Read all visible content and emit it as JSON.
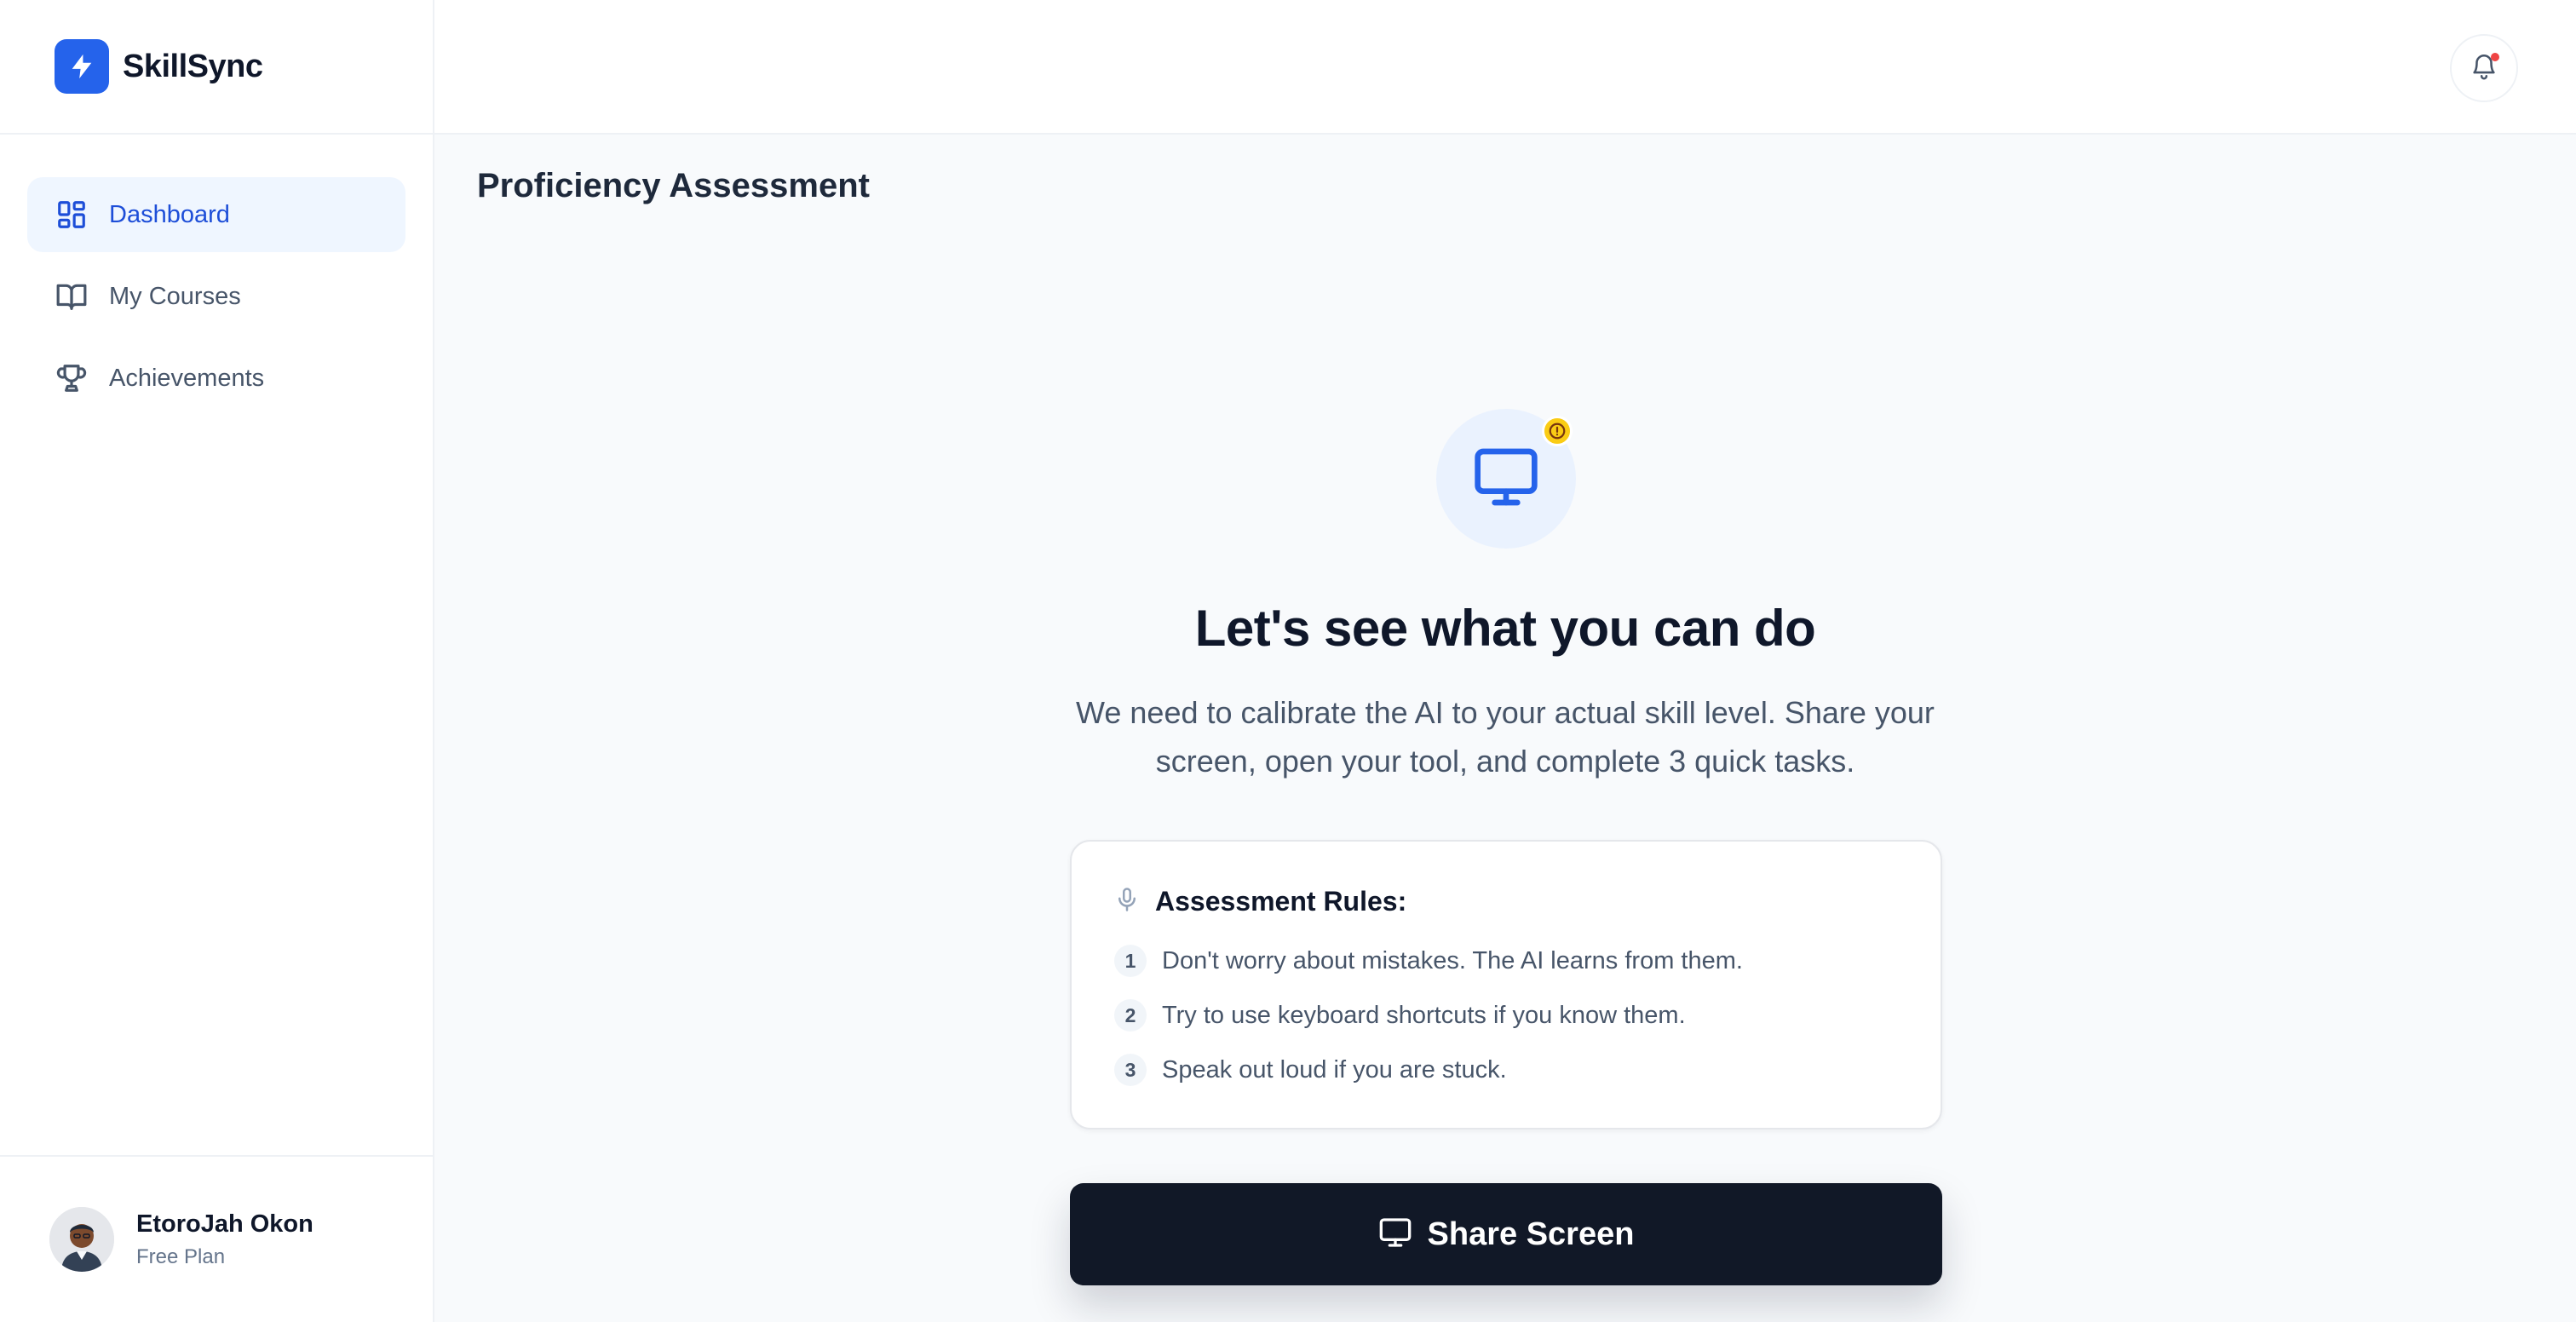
{
  "brand": {
    "name": "SkillSync",
    "logo_icon": "lightning-bolt-icon",
    "accent": "#2563eb"
  },
  "sidebar": {
    "items": [
      {
        "label": "Dashboard",
        "icon": "dashboard-grid-icon",
        "active": true
      },
      {
        "label": "My Courses",
        "icon": "book-open-icon",
        "active": false
      },
      {
        "label": "Achievements",
        "icon": "trophy-icon",
        "active": false
      }
    ]
  },
  "user": {
    "name": "EtoroJah Okon",
    "plan": "Free Plan"
  },
  "topbar": {
    "notification_icon": "bell-icon",
    "has_unread": true
  },
  "main": {
    "page_title": "Proficiency Assessment",
    "hero_icon": "monitor-icon",
    "hero_badge_icon": "alert-circle-icon",
    "headline": "Let's see what you can do",
    "subtext": "We need to calibrate the AI to your actual skill level. Share your screen, open your tool, and complete 3 quick tasks.",
    "rules": {
      "title": "Assessment Rules:",
      "icon": "microphone-icon",
      "items": [
        {
          "num": "1",
          "text": "Don't worry about mistakes. The AI learns from them."
        },
        {
          "num": "2",
          "text": "Try to use keyboard shortcuts if you know them."
        },
        {
          "num": "3",
          "text": "Speak out loud if you are stuck."
        }
      ]
    },
    "share_button": {
      "label": "Share Screen",
      "icon": "monitor-icon"
    }
  },
  "colors": {
    "primary": "#2563eb",
    "dark_button": "#111827",
    "warning": "#facc15",
    "notification_dot": "#ef4444"
  }
}
